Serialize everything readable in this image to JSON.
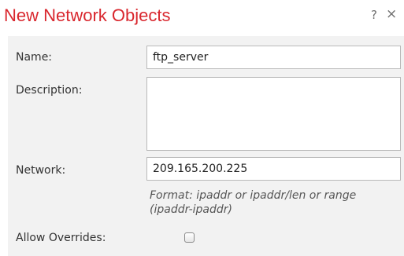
{
  "dialog": {
    "title": "New Network Objects",
    "help_icon": "?",
    "close_icon": "×"
  },
  "form": {
    "name_label": "Name:",
    "name_value": "ftp_server",
    "description_label": "Description:",
    "description_value": "",
    "network_label": "Network:",
    "network_value": "209.165.200.225",
    "network_hint": "Format: ipaddr or ipaddr/len or range (ipaddr-ipaddr)",
    "allow_overrides_label": "Allow Overrides:",
    "allow_overrides_checked": false
  },
  "colors": {
    "title": "#d9272e",
    "panel_background": "#f2f2f2",
    "input_border": "#b9b9b9"
  },
  "icons": {
    "help": "help-icon",
    "close": "close-icon",
    "checkbox": "checkbox-unchecked"
  }
}
